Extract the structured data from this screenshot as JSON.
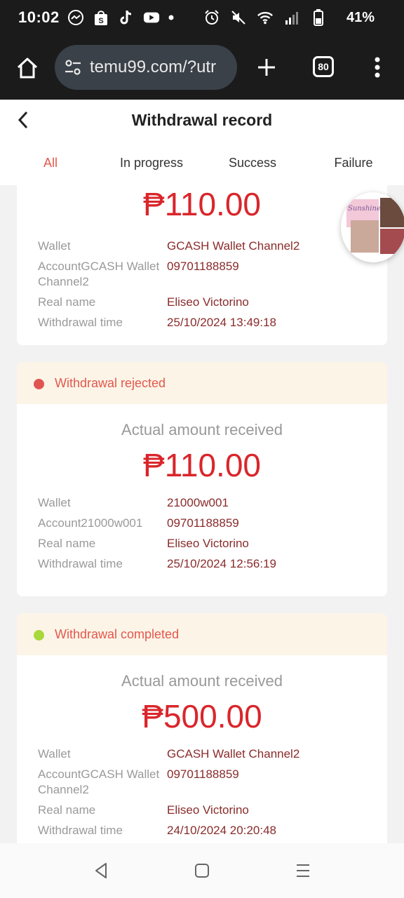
{
  "status_bar": {
    "time": "10:02",
    "battery": "41%",
    "left_icons": [
      "messenger-icon",
      "shopee-icon",
      "tiktok-icon",
      "youtube-icon",
      "dot-icon"
    ],
    "right_icons": [
      "alarm-icon",
      "mute-icon",
      "wifi-icon",
      "signal-icon",
      "battery-icon"
    ]
  },
  "browser": {
    "url": "temu99.com/?utr",
    "tab_count": "80"
  },
  "page": {
    "title": "Withdrawal record"
  },
  "tabs": [
    {
      "label": "All",
      "active": true
    },
    {
      "label": "In progress",
      "active": false
    },
    {
      "label": "Success",
      "active": false
    },
    {
      "label": "Failure",
      "active": false
    }
  ],
  "floating_widget_text": "Sunshine",
  "records": [
    {
      "status": "",
      "amount_label": "",
      "amount": "₱110.00",
      "wallet_key": "Wallet",
      "wallet": "GCASH Wallet Channel2",
      "account_key": "AccountGCASH Wallet Channel2",
      "account": "09701188859",
      "name_key": "Real name",
      "name": "Eliseo Victorino",
      "time_key": "Withdrawal time",
      "time": "25/10/2024 13:49:18"
    },
    {
      "status": "Withdrawal rejected",
      "status_color": "#e05552",
      "amount_label": "Actual amount received",
      "amount": "₱110.00",
      "wallet_key": "Wallet",
      "wallet": "21000w001",
      "account_key": "Account21000w001",
      "account": "09701188859",
      "name_key": "Real name",
      "name": "Eliseo Victorino",
      "time_key": "Withdrawal time",
      "time": "25/10/2024 12:56:19"
    },
    {
      "status": "Withdrawal completed",
      "status_color": "#a8d83c",
      "amount_label": "Actual amount received",
      "amount": "₱500.00",
      "wallet_key": "Wallet",
      "wallet": "GCASH Wallet Channel2",
      "account_key": "AccountGCASH Wallet Channel2",
      "account": "09701188859",
      "name_key": "Real name",
      "name": "Eliseo Victorino",
      "time_key": "Withdrawal time",
      "time": "24/10/2024 20:20:48"
    }
  ],
  "colors": {
    "accent": "#e2584c",
    "amount": "#d9262b",
    "status_bg": "#fdf4e8",
    "value_text": "#8a2b2b"
  }
}
